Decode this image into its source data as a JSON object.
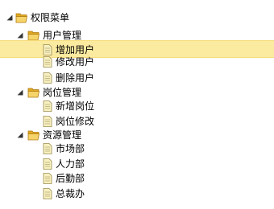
{
  "tree": {
    "root": {
      "label": "权限菜单",
      "icon": "folder-open-icon"
    },
    "groups": [
      {
        "label": "用户管理",
        "icon": "folder-open-icon",
        "items": [
          {
            "label": "增加用户",
            "icon": "document-icon",
            "selected": true
          },
          {
            "label": "修改用户",
            "icon": "document-icon"
          },
          {
            "label": "删除用户",
            "icon": "document-icon"
          }
        ]
      },
      {
        "label": "岗位管理",
        "icon": "folder-open-icon",
        "items": [
          {
            "label": "新增岗位",
            "icon": "document-icon"
          },
          {
            "label": "岗位修改",
            "icon": "document-icon"
          }
        ]
      },
      {
        "label": "资源管理",
        "icon": "folder-open-icon",
        "items": [
          {
            "label": "市场部",
            "icon": "document-icon"
          },
          {
            "label": "人力部",
            "icon": "document-icon"
          },
          {
            "label": "后勤部",
            "icon": "document-icon"
          },
          {
            "label": "总裁办",
            "icon": "document-icon"
          }
        ]
      }
    ]
  },
  "colors": {
    "selected_bg": "#fbeba0",
    "folder": "#f0c040",
    "document": "#f7f0c0"
  }
}
